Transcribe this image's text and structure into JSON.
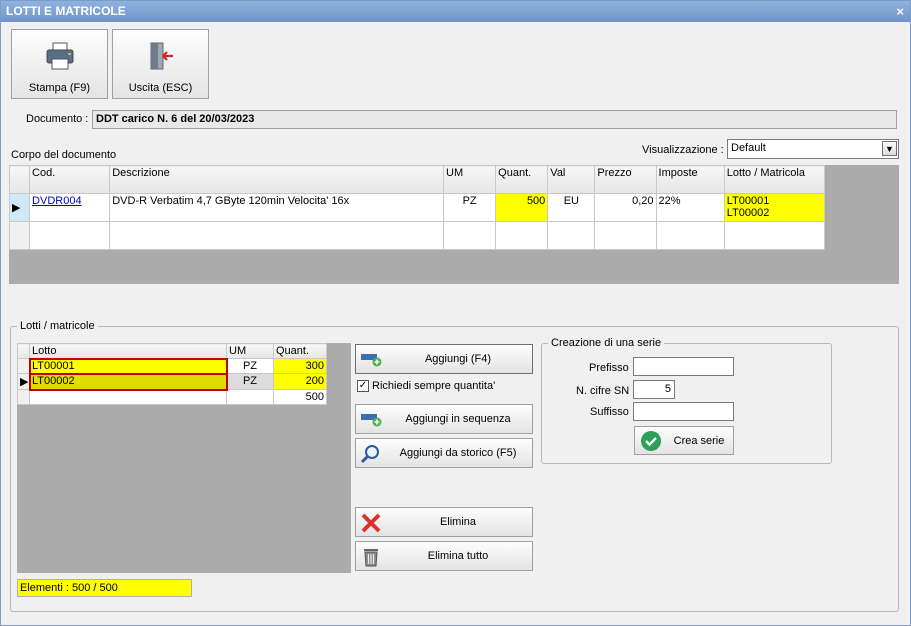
{
  "window": {
    "title": "LOTTI E MATRICOLE",
    "close": "×"
  },
  "toolbar": {
    "print_label": "Stampa (F9)",
    "exit_label": "Uscita (ESC)"
  },
  "document": {
    "label": "Documento :",
    "value": "DDT carico N. 6 del 20/03/2023"
  },
  "body_section": {
    "title": "Corpo del documento",
    "view_label": "Visualizzazione :",
    "view_value": "Default",
    "columns": [
      "Cod.",
      "Descrizione",
      "UM",
      "Quant.",
      "Val",
      "Prezzo",
      "Imposte",
      "Lotto / Matricola"
    ],
    "rows": [
      {
        "cod": "DVDR004",
        "descrizione": "DVD-R Verbatim 4,7 GByte 120min  Velocita' 16x",
        "um": "PZ",
        "quant": "500",
        "val": "EU",
        "prezzo": "0,20",
        "imposte": "22%",
        "lotto1": "LT00001",
        "lotto2": "LT00002"
      }
    ]
  },
  "lots": {
    "group_title": "Lotti / matricole",
    "columns": [
      "Lotto",
      "UM",
      "Quant."
    ],
    "rows": [
      {
        "lotto": "LT00001",
        "um": "PZ",
        "quant": "300"
      },
      {
        "lotto": "LT00002",
        "um": "PZ",
        "quant": "200"
      }
    ],
    "total": "500",
    "status": "Elementi : 500 / 500"
  },
  "actions": {
    "add": "Aggiungi (F4)",
    "always_ask_qty": "Richiedi sempre quantita'",
    "add_sequence": "Aggiungi in sequenza",
    "add_history": "Aggiungi da storico (F5)",
    "delete": "Elimina",
    "delete_all": "Elimina tutto"
  },
  "series": {
    "group_title": "Creazione di una serie",
    "prefix_label": "Prefisso",
    "prefix_value": "",
    "digits_label": "N. cifre SN",
    "digits_value": "5",
    "suffix_label": "Suffisso",
    "suffix_value": "",
    "create_label": "Crea serie"
  }
}
